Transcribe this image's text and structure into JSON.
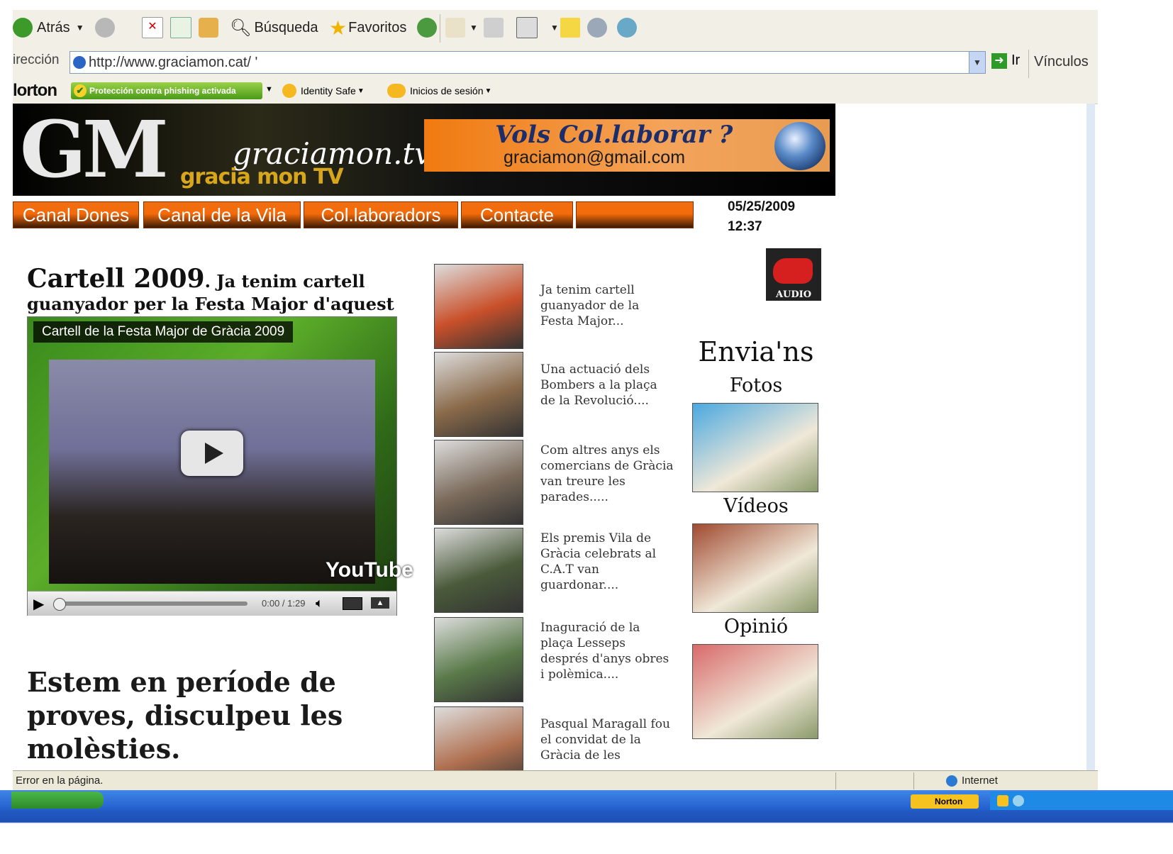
{
  "browser": {
    "toolbar": {
      "back_label": "Atrás",
      "search_label": "Búsqueda",
      "favorites_label": "Favoritos"
    },
    "address": {
      "label": "irección",
      "url": "http://www.graciamon.cat/ '",
      "go_label": "Ir",
      "links_label": "Vínculos"
    },
    "norton": {
      "brand": "lorton",
      "phishing": "Protección contra phishing activada",
      "identity": "Identity Safe",
      "logins": "Inicios de sesión"
    },
    "status": {
      "message": "Error en la página.",
      "zone": "Internet"
    },
    "taskbar": {
      "norton_label": "Norton"
    }
  },
  "site": {
    "logo": {
      "letters": "GM",
      "name": "graciamon.tv",
      "subname": "gracia mon TV"
    },
    "collab": {
      "title": "Vols Col.laborar ?",
      "email": "graciamon@gmail.com"
    },
    "nav": [
      {
        "label": "Canal Dones"
      },
      {
        "label": "Canal de la Vila"
      },
      {
        "label": "Col.laboradors"
      },
      {
        "label": "Contacte"
      },
      {
        "label": ""
      }
    ],
    "date": "05/25/2009",
    "time": "12:37",
    "audio_label": "AUDIO",
    "headline": {
      "big": "Cartell 2009",
      "rest": ". Ja tenim cartell guanyador per la Festa Major d'aquest"
    },
    "video": {
      "title": "Cartell de la Festa Major de Gràcia 2009",
      "time": "0:00 / 1:29",
      "progress": 0,
      "brand": "YouTube"
    },
    "notice": "Estem en període de proves, disculpeu les molèsties.",
    "news": [
      {
        "text": "Ja tenim cartell guanyador de la Festa Major...",
        "color": "#c9502a"
      },
      {
        "text": "Una actuació dels Bombers a la plaça de la Revolució....",
        "color": "#8a6a4a"
      },
      {
        "text": "Com altres anys els comercians de Gràcia van treure les parades.....",
        "color": "#7a6a5a"
      },
      {
        "text": "Els premis Vila de Gràcia celebrats al C.A.T van guardonar....",
        "color": "#4a5a3a"
      },
      {
        "text": "Inaguració de la plaça Lesseps després d'anys obres i polèmica....",
        "color": "#5a7a4a"
      },
      {
        "text": "Pasqual Maragall fou el convidat de la Gràcia de les",
        "color": "#b07050"
      }
    ],
    "sidebar": {
      "title": "Envia'ns",
      "items": [
        {
          "label": "Fotos",
          "color": "#4aa8e0"
        },
        {
          "label": "Vídeos",
          "color": "#a04a30"
        },
        {
          "label": "Opinió",
          "color": "#d86a6a"
        }
      ]
    }
  }
}
